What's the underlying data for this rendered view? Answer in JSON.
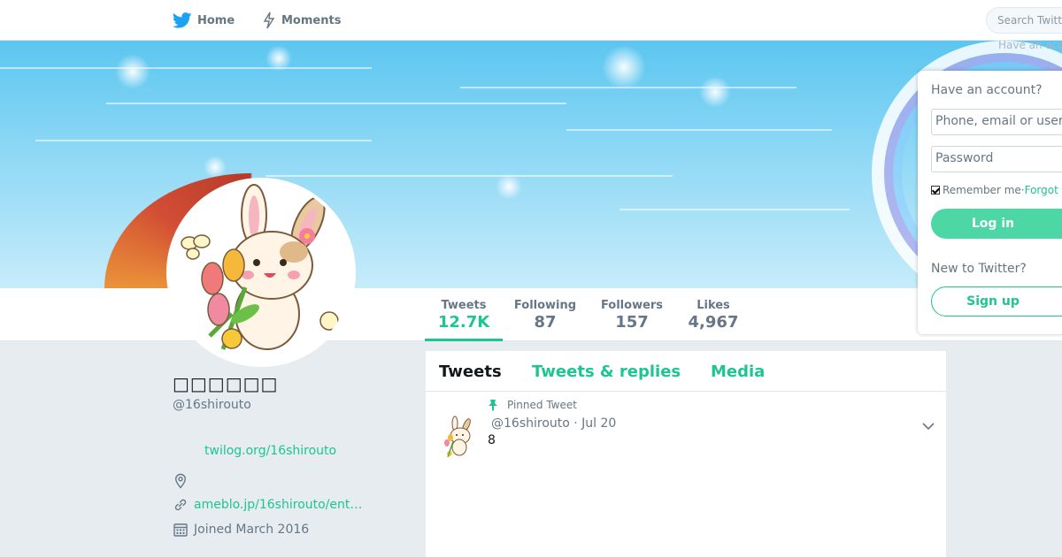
{
  "nav": {
    "home_label": "Home",
    "moments_label": "Moments",
    "search_placeholder": "Search Twitt",
    "have_account_small": "Have an acc"
  },
  "profile": {
    "name": "□□□□□□",
    "handle": "@16shirouto",
    "bio_link": "twilog.org/16shirouto",
    "website": "ameblo.jp/16shirouto/ent…",
    "joined": "Joined March 2016"
  },
  "stats": [
    {
      "label": "Tweets",
      "value": "12.7K",
      "active": true
    },
    {
      "label": "Following",
      "value": "87"
    },
    {
      "label": "Followers",
      "value": "157"
    },
    {
      "label": "Likes",
      "value": "4,967"
    }
  ],
  "tabs": {
    "tweets": "Tweets",
    "replies": "Tweets & replies",
    "media": "Media"
  },
  "tweet": {
    "pinned_label": "Pinned Tweet",
    "meta": "@16shirouto · Jul 20",
    "text": "8"
  },
  "login": {
    "heading": "Have an account?",
    "username_placeholder": "Phone, email or user",
    "password_placeholder": "Password",
    "remember_label": "Remember me",
    "separator": " · ",
    "forgot_label": "Forgot",
    "login_button": "Log in",
    "new_heading": "New to Twitter?",
    "signup_button": "Sign up"
  },
  "colors": {
    "accent": "#1dc592",
    "login_button": "#4dd7a5",
    "twitter_blue": "#1da1f2"
  },
  "icons": [
    "twitter-bird-icon",
    "moments-bolt-icon",
    "pin-icon",
    "location-icon",
    "link-icon",
    "calendar-icon",
    "chevron-down-icon"
  ]
}
